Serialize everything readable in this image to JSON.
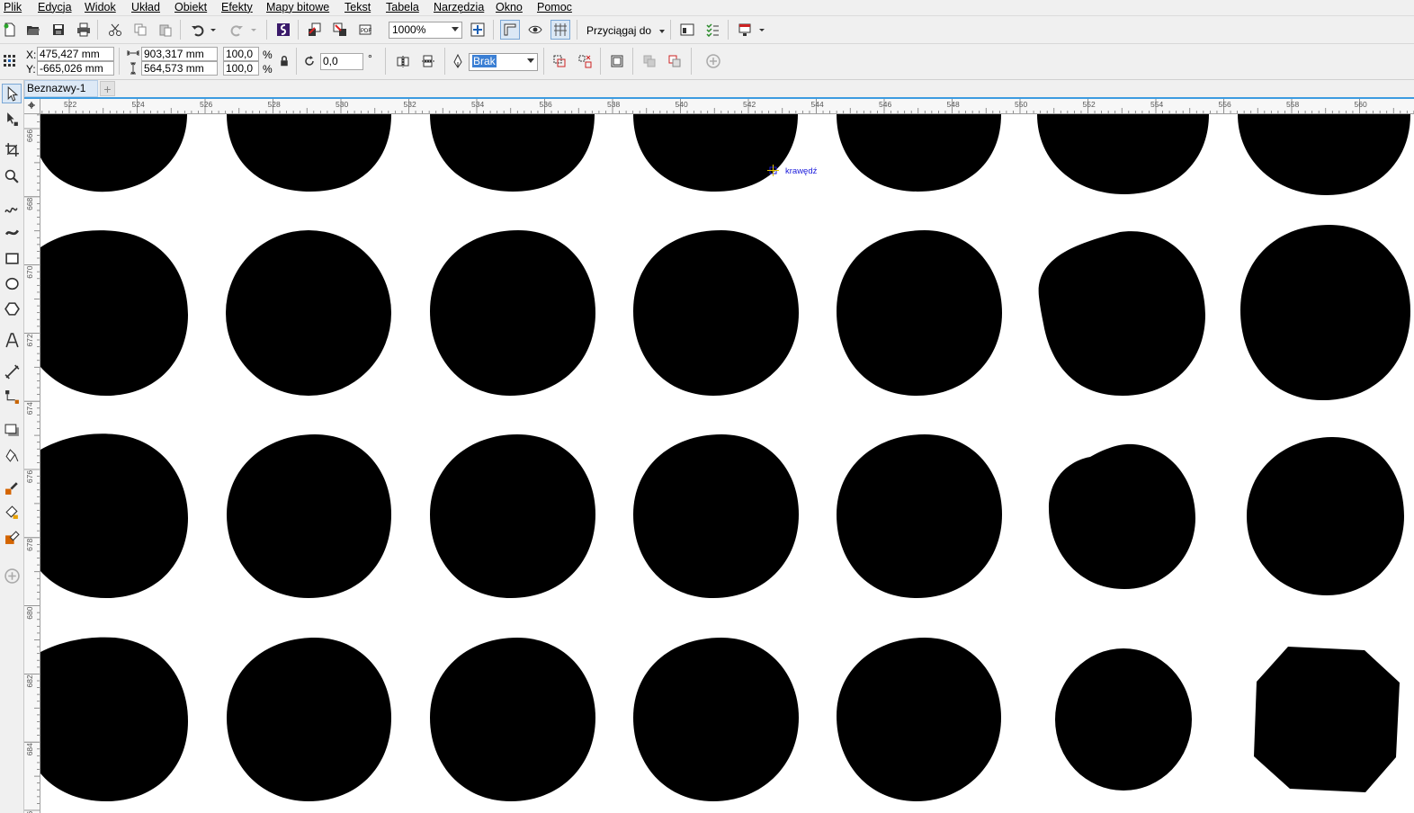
{
  "menu": [
    "Plik",
    "Edycja",
    "Widok",
    "Układ",
    "Obiekt",
    "Efekty",
    "Mapy bitowe",
    "Tekst",
    "Tabela",
    "Narzędzia",
    "Okno",
    "Pomoc"
  ],
  "toolbar": {
    "zoom": "1000%",
    "snap_label": "Przyciągaj do"
  },
  "properties": {
    "x_label": "X:",
    "y_label": "Y:",
    "x_value": "475,427 mm",
    "y_value": "-665,026 mm",
    "width_value": "903,317 mm",
    "height_value": "564,573 mm",
    "scale_x": "100,0",
    "scale_y": "100,0",
    "percent": "%",
    "rotation": "0,0",
    "degree": "°",
    "outline": "Brak"
  },
  "document": {
    "tab": "Beznazwy-1",
    "add_tab": "+"
  },
  "hruler_labels": [
    "522",
    "524",
    "526",
    "528",
    "530",
    "532",
    "534",
    "536",
    "538",
    "540",
    "542",
    "544",
    "546",
    "548",
    "550",
    "552",
    "554",
    "556",
    "558",
    "560"
  ],
  "vruler_labels": [
    "666",
    "668",
    "670",
    "672",
    "674",
    "676",
    "678",
    "680",
    "682",
    "684",
    "686"
  ],
  "canvas": {
    "snap_hint": "krawędź"
  }
}
